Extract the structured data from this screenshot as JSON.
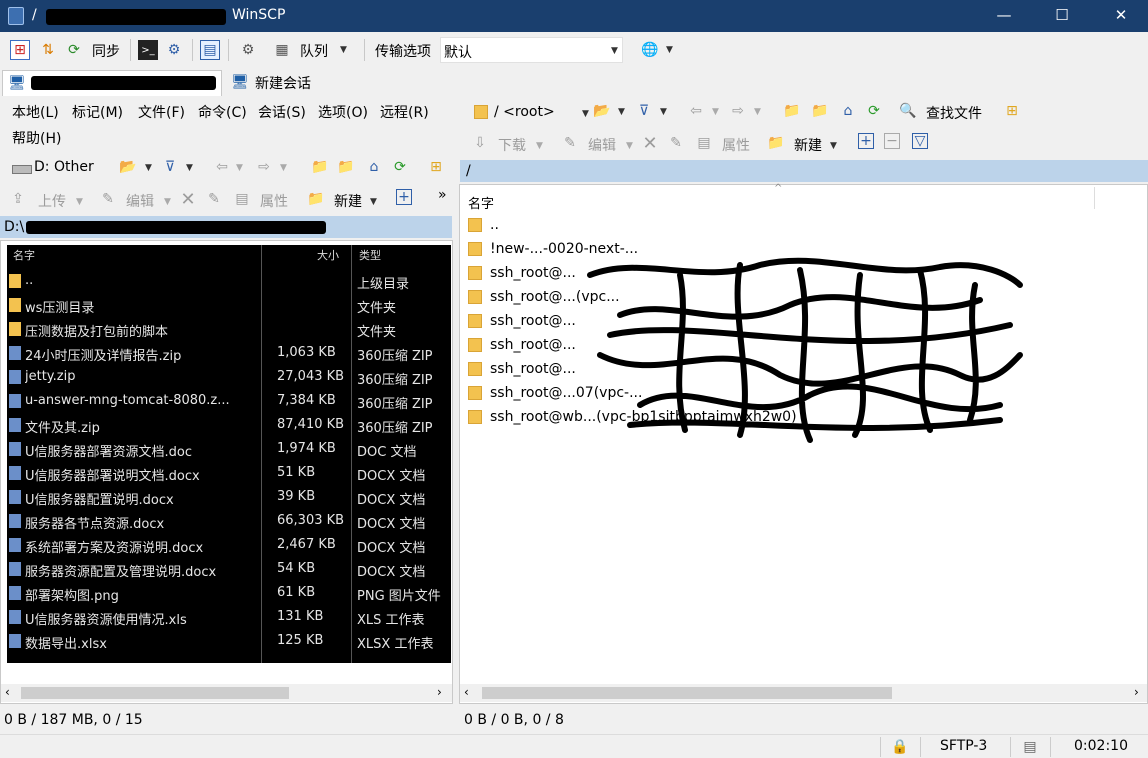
{
  "window": {
    "title_prefix": "/",
    "title_suffix": "WinSCP",
    "minimize": "—",
    "maximize": "☐",
    "close": "✕"
  },
  "toolbar1": {
    "sync_label": "同步",
    "queue_label": "队列",
    "transfer_opts_label": "传输选项",
    "transfer_preset": "默认"
  },
  "session_tabs": {
    "new_session_label": "新建会话"
  },
  "left_menu": [
    "本地(L)",
    "标记(M)",
    "文件(F)",
    "命令(C)",
    "会话(S)",
    "选项(O)",
    "远程(R)",
    "帮助(H)"
  ],
  "left_panel": {
    "drive_label": "D: Other",
    "upload_label": "上传",
    "edit_label": "编辑",
    "properties_label": "属性",
    "new_label": "新建",
    "path_prefix": "D:\\",
    "status": "0 B / 187 MB,   0 / 15",
    "rows": [
      {
        "name": "..",
        "size": "",
        "type": "上级目录"
      },
      {
        "name": "ws压测目录",
        "size": "",
        "type": "文件夹"
      },
      {
        "name": "压测数据及打包前的脚本",
        "size": "",
        "type": "文件夹"
      },
      {
        "name": "24小时压测及详情报告.zip",
        "size": "1,063 KB",
        "type": "360压缩 ZIP"
      },
      {
        "name": "jetty.zip",
        "size": "27,043 KB",
        "type": "360压缩 ZIP"
      },
      {
        "name": "u-answer-mng-tomcat-8080.z...",
        "size": "7,384 KB",
        "type": "360压缩 ZIP"
      },
      {
        "name": "文件及其.zip",
        "size": "87,410 KB",
        "type": "360压缩 ZIP"
      },
      {
        "name": "U信服务器部署资源文档.doc",
        "size": "1,974 KB",
        "type": "DOC 文档"
      },
      {
        "name": "U信服务器部署说明文档.docx",
        "size": "51 KB",
        "type": "DOCX 文档"
      },
      {
        "name": "U信服务器配置说明.docx",
        "size": "39 KB",
        "type": "DOCX 文档"
      },
      {
        "name": "服务器各节点资源.docx",
        "size": "66,303 KB",
        "type": "DOCX 文档"
      },
      {
        "name": "系统部署方案及资源说明.docx",
        "size": "2,467 KB",
        "type": "DOCX 文档"
      },
      {
        "name": "服务器资源配置及管理说明.docx",
        "size": "54 KB",
        "type": "DOCX 文档"
      },
      {
        "name": "部署架构图.png",
        "size": "61 KB",
        "type": "PNG 图片文件"
      },
      {
        "name": "U信服务器资源使用情况.xls",
        "size": "131 KB",
        "type": "XLS 工作表"
      },
      {
        "name": "数据导出.xlsx",
        "size": "125 KB",
        "type": "XLSX 工作表"
      }
    ],
    "col_name": "名字",
    "col_size": "大小",
    "col_type": "类型"
  },
  "right_panel": {
    "root_label": "/ <root>",
    "find_files_label": "查找文件",
    "download_label": "下载",
    "edit_label": "编辑",
    "properties_label": "属性",
    "new_label": "新建",
    "path": "/",
    "col_name": "名字",
    "status": "0 B / 0 B,   0 / 8",
    "rows": [
      {
        "name": ".."
      },
      {
        "name": "!new-...-0020-next-..."
      },
      {
        "name": "ssh_root@..."
      },
      {
        "name": "ssh_root@...(vpc..."
      },
      {
        "name": "ssh_root@..."
      },
      {
        "name": "ssh_root@..."
      },
      {
        "name": "ssh_root@..."
      },
      {
        "name": "ssh_root@...07(vpc-..."
      },
      {
        "name": "ssh_root@wb...(vpc-bp1sjtbpptajmwxh2w0)"
      }
    ]
  },
  "statusbar": {
    "protocol": "SFTP-3",
    "elapsed": "0:02:10"
  }
}
